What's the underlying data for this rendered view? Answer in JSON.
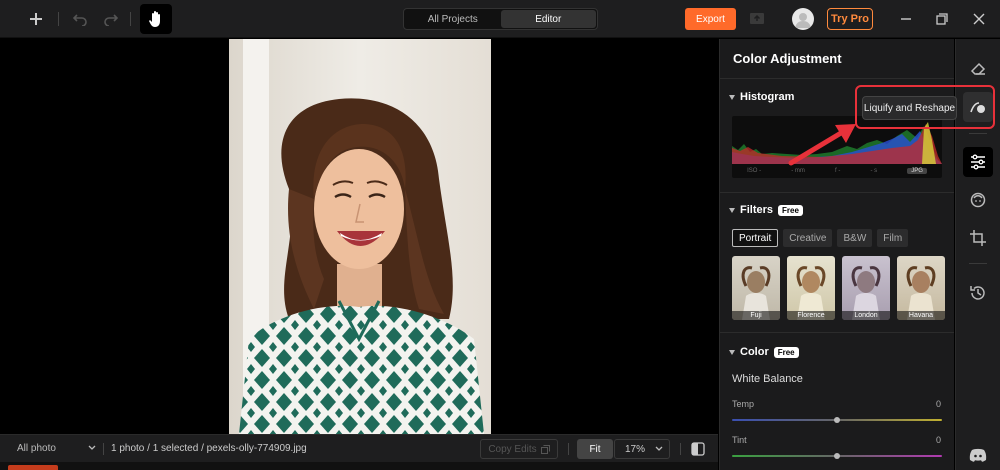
{
  "topbar": {
    "tabs": [
      {
        "label": "All Projects",
        "active": false
      },
      {
        "label": "Editor",
        "active": true
      }
    ],
    "export_label": "Export",
    "try_pro_label": "Try Pro",
    "accent_color": "#ff6a2a"
  },
  "bottombar": {
    "filter_value": "All photo",
    "info": "1 photo / 1 selected / pexels-olly-774909.jpg",
    "copy_edits_label": "Copy Edits",
    "fit_label": "Fit",
    "zoom_value": "17%"
  },
  "panel": {
    "title": "Color Adjustment",
    "histogram": {
      "label": "Histogram",
      "meta": [
        "ISO -",
        "- mm",
        "f -",
        "- s"
      ],
      "format": "JPG"
    },
    "filters": {
      "label": "Filters",
      "badge": "Free",
      "tabs": [
        {
          "label": "Portrait",
          "active": true
        },
        {
          "label": "Creative",
          "active": false
        },
        {
          "label": "B&W",
          "active": false
        },
        {
          "label": "Film",
          "active": false
        }
      ],
      "thumbs": [
        {
          "label": "Fuji"
        },
        {
          "label": "Florence"
        },
        {
          "label": "London"
        },
        {
          "label": "Havana"
        }
      ]
    },
    "color": {
      "label": "Color",
      "badge": "Free",
      "white_balance_label": "White Balance",
      "temp_label": "Temp",
      "temp_value": "0",
      "tint_label": "Tint",
      "tint_value": "0"
    }
  },
  "tooltip": {
    "text": "Liquify and Reshape"
  },
  "tools": [
    "eraser-icon",
    "liquify-icon",
    "adjust-sliders-icon",
    "face-retouch-icon",
    "crop-icon",
    "history-icon",
    "discord-icon"
  ]
}
